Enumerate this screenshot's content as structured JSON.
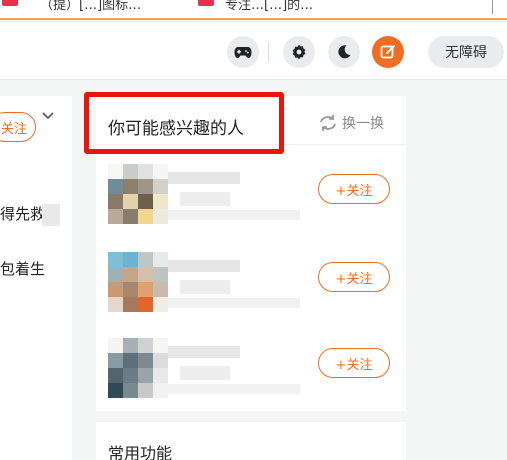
{
  "tabs": [
    {
      "label": "（提）[…]图标…"
    },
    {
      "label": "专注…[…]的…"
    }
  ],
  "header": {
    "accessibility_label": "无障碍",
    "icons": [
      "gamepad-icon",
      "gear-icon",
      "moon-icon",
      "edit-icon"
    ],
    "accent_color": "#f26d24"
  },
  "left_feed": {
    "follow_label": "关注",
    "text_1": "得先救",
    "text_2": "包着生"
  },
  "recommend": {
    "title": "你可能感兴趣的人",
    "refresh_label": "换一换",
    "users": [
      {
        "follow_label": "+关注"
      },
      {
        "follow_label": "+关注"
      },
      {
        "follow_label": "+关注"
      }
    ]
  },
  "common": {
    "title": "常用功能"
  },
  "highlight_color": "#e8140e"
}
